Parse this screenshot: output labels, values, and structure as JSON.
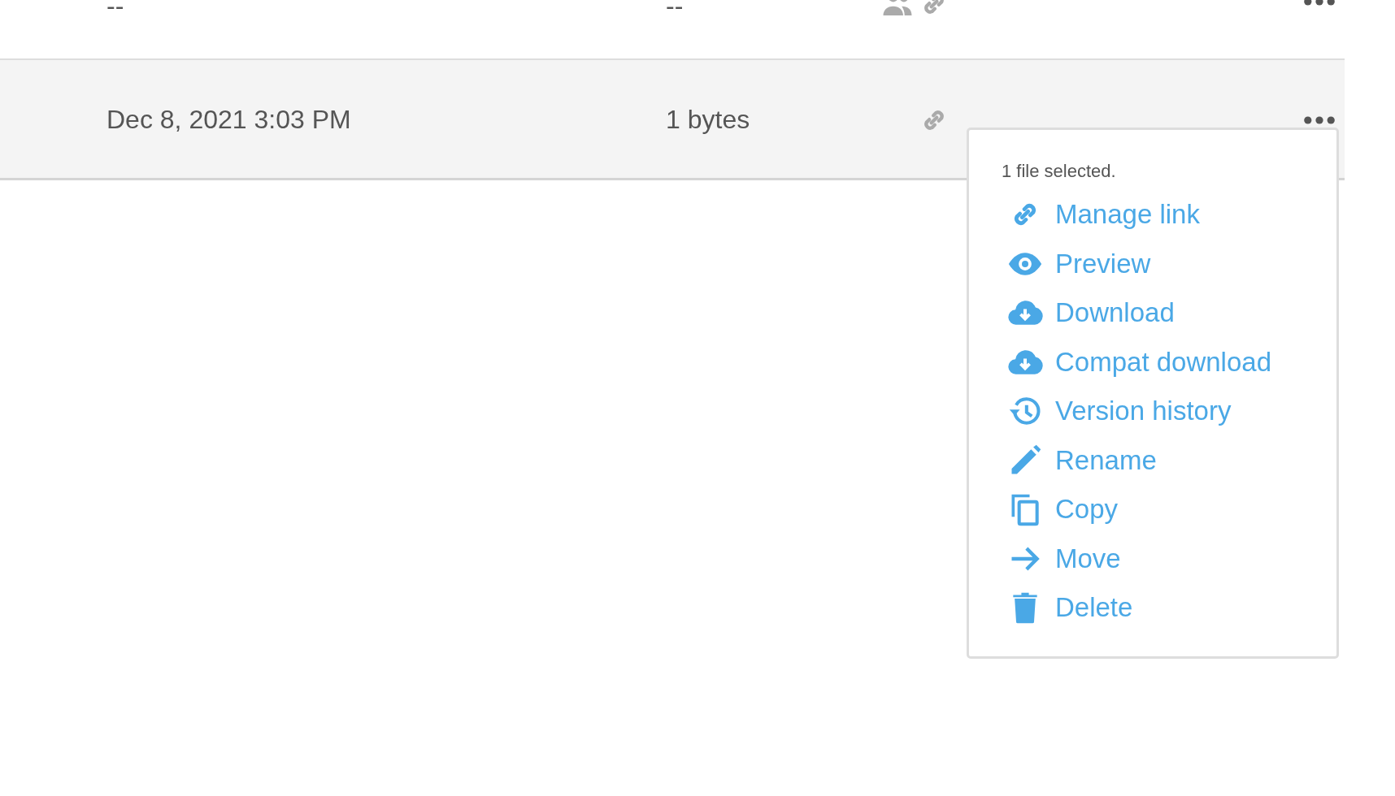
{
  "rows": [
    {
      "modified": "--",
      "size": "--",
      "shared": true,
      "has_link": true
    },
    {
      "modified": "Dec 8, 2021 3:03 PM",
      "size": "1 bytes",
      "shared": false,
      "has_link": true,
      "selected": true
    }
  ],
  "context_menu": {
    "header": "1 file selected.",
    "items": [
      "Manage link",
      "Preview",
      "Download",
      "Compat download",
      "Version history",
      "Rename",
      "Copy",
      "Move",
      "Delete"
    ]
  }
}
